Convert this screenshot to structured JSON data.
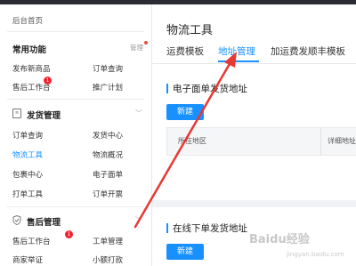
{
  "sidebar": {
    "home": "后台首页",
    "common": {
      "title": "常用功能",
      "manage": "管理",
      "items": [
        "发布新商品",
        "订单查询",
        "售后工作台",
        "推广计划"
      ],
      "badge": "1"
    },
    "shipping": {
      "title": "发货管理",
      "items": [
        "订单查询",
        "发货中心",
        "物流工具",
        "物流概况",
        "包裹中心",
        "电子面单",
        "打单工具",
        "订单开票"
      ]
    },
    "aftersale": {
      "title": "售后管理",
      "items": [
        "售后工作台",
        "工单管理",
        "商家举证",
        "小额打款"
      ],
      "badge": "1"
    }
  },
  "main": {
    "title": "物流工具",
    "tabs": [
      "运费模板",
      "地址管理",
      "加运费发顺丰模板"
    ],
    "active_tab": "地址管理",
    "section1": {
      "title": "电子面单发货地址",
      "button": "新建",
      "columns": [
        "所在地区",
        "详细地址"
      ]
    },
    "section2": {
      "title": "在线下单发货地址",
      "button": "新建"
    }
  },
  "watermark": {
    "brand": "Baidu经验",
    "url": "jingyan.baidu.com"
  },
  "colors": {
    "accent": "#1890ff",
    "arrow": "#e53935",
    "badge": "#f5222d"
  }
}
